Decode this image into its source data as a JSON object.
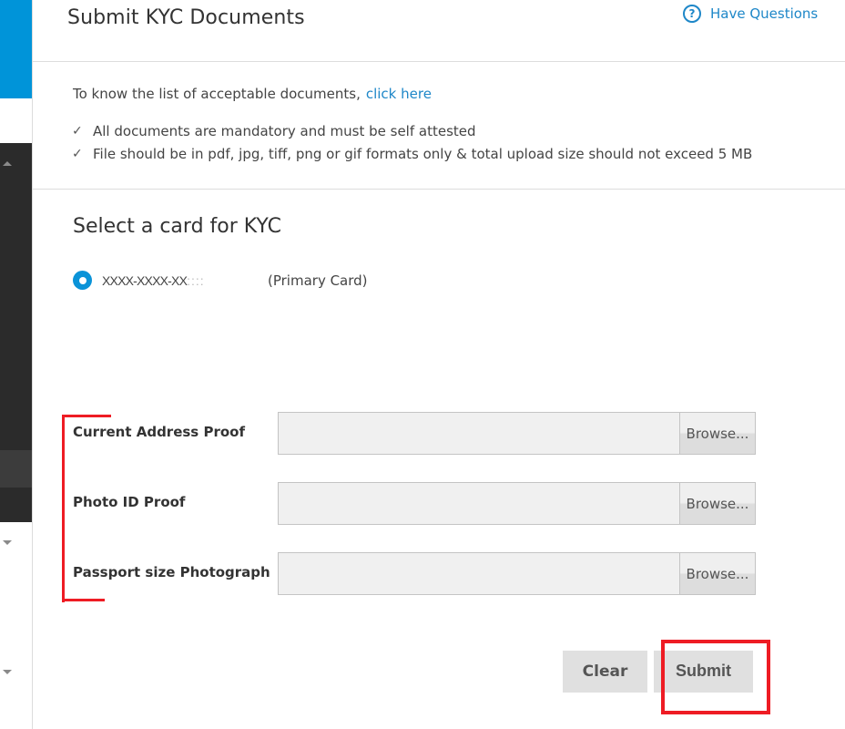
{
  "header": {
    "title": "Submit KYC Documents",
    "help_link": {
      "label": "Have Questions",
      "icon": "question-circle-icon",
      "icon_glyph": "?"
    }
  },
  "info": {
    "prefix": "To know the list of acceptable documents,",
    "link_label": "click here",
    "notes": [
      {
        "icon": "check-icon",
        "glyph": "✓",
        "text": "All documents are mandatory and must be self attested"
      },
      {
        "icon": "check-icon",
        "glyph": "✓",
        "text": "File should be in pdf, jpg, tiff, png or gif formats only & total upload size should not exceed 5 MB"
      }
    ]
  },
  "card_selection": {
    "title": "Select a card for KYC",
    "cards": [
      {
        "number_masked": "XXXX-XXXX-XX",
        "number_redacted": "::::",
        "type_label": "(Primary Card)",
        "selected": true
      }
    ]
  },
  "uploads": [
    {
      "label": "Current Address Proof",
      "value": "",
      "browse_label": "Browse..."
    },
    {
      "label": "Photo ID Proof",
      "value": "",
      "browse_label": "Browse..."
    },
    {
      "label": "Passport size Photograph",
      "value": "",
      "browse_label": "Browse..."
    }
  ],
  "actions": {
    "clear_label": "Clear",
    "submit_label": "Submit"
  },
  "colors": {
    "accent": "#0094d9",
    "link": "#1e87c8",
    "sidebar_dark": "#2b2b2b",
    "annotation_red": "#ee1c24",
    "button_gray": "#e0e0e0"
  }
}
